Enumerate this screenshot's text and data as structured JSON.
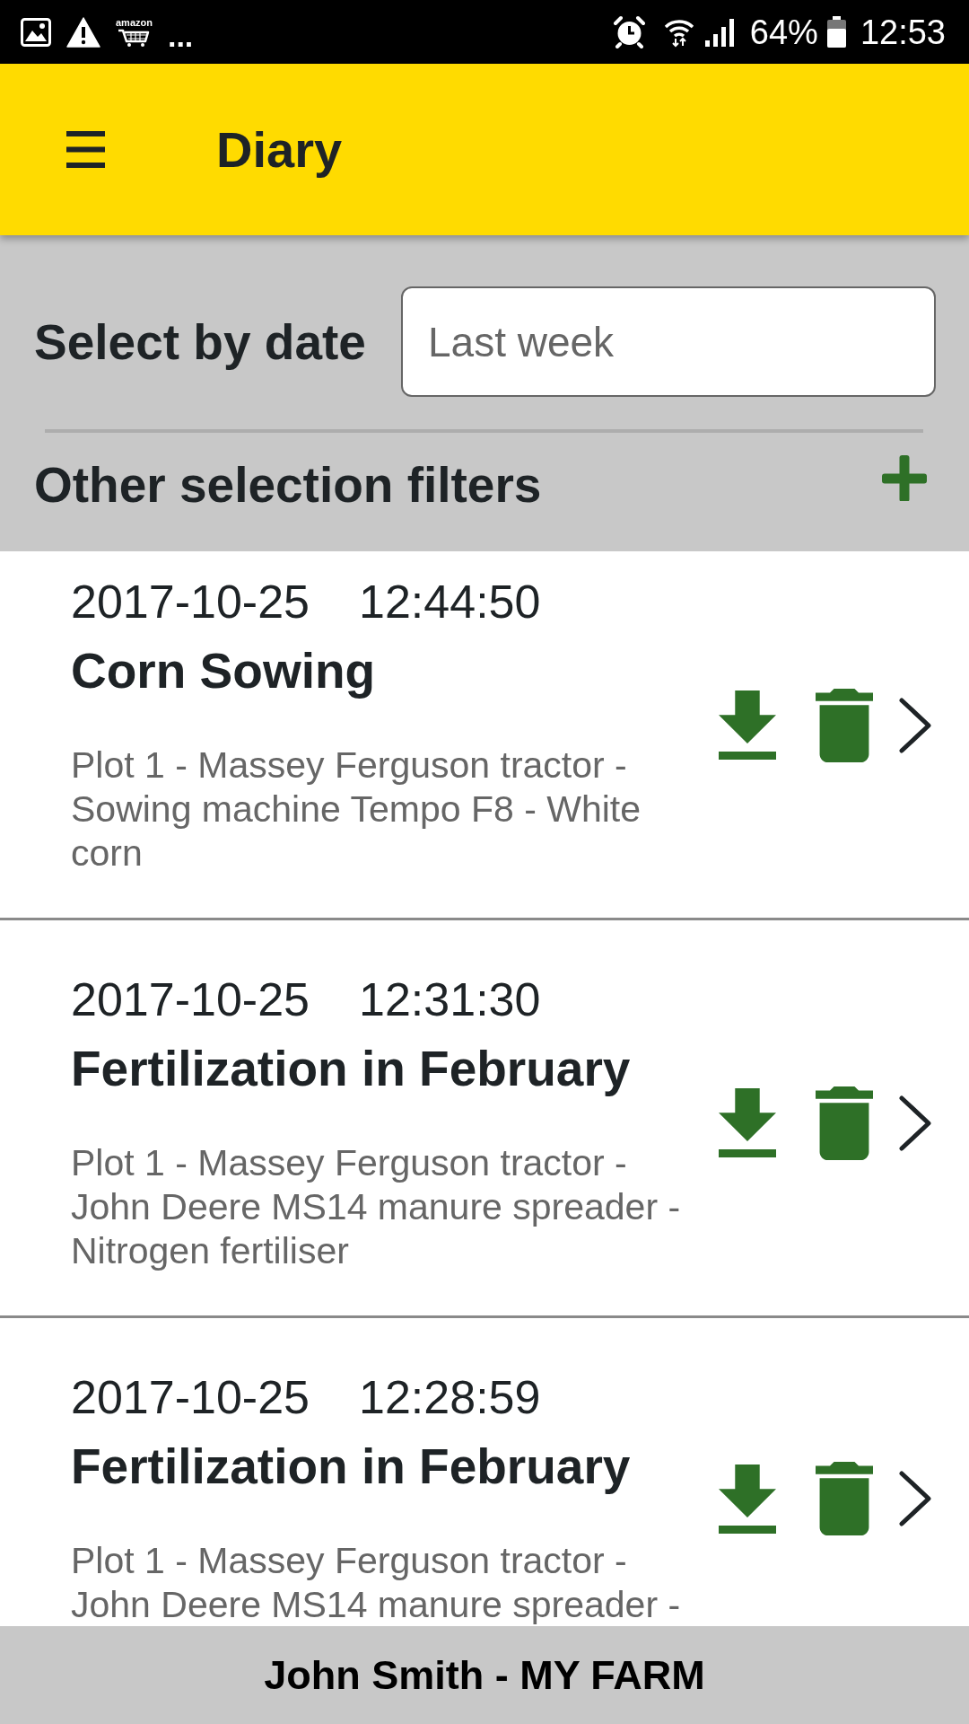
{
  "status_bar": {
    "notification_app_label": "amazon",
    "more_indicator": "...",
    "battery_percent": "64%",
    "time": "12:53"
  },
  "app_bar": {
    "title": "Diary"
  },
  "filters": {
    "date_label": "Select by date",
    "date_field": {
      "placeholder": "Last week"
    },
    "other_filters_label": "Other selection filters"
  },
  "entries": [
    {
      "date": "2017-10-25",
      "time": "12:44:50",
      "title": "Corn Sowing",
      "description": "Plot 1 - Massey Ferguson tractor - Sowing machine Tempo F8 - White corn"
    },
    {
      "date": "2017-10-25",
      "time": "12:31:30",
      "title": "Fertilization in February",
      "description": "Plot 1 - Massey Ferguson tractor - John Deere MS14 manure spreader - Nitrogen fertiliser"
    },
    {
      "date": "2017-10-25",
      "time": "12:28:59",
      "title": "Fertilization in February",
      "description": "Plot 1 - Massey Ferguson tractor - John Deere MS14 manure spreader -"
    }
  ],
  "footer": {
    "user_farm": "John Smith - MY FARM"
  }
}
